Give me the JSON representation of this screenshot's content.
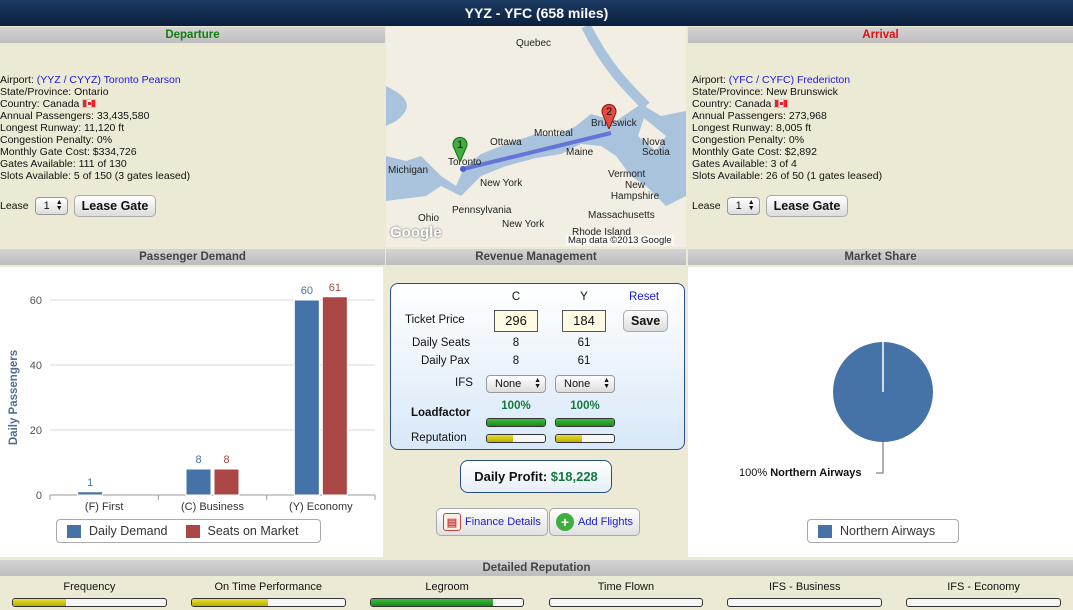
{
  "title": "YYZ - YFC (658 miles)",
  "departure": {
    "header": "Departure",
    "airport_label": "Airport:",
    "airport_value": "(YYZ / CYYZ) Toronto Pearson",
    "rows": [
      "State/Province: Ontario",
      "Country: Canada",
      "Annual Passengers: 33,435,580",
      "Longest Runway: 11,120 ft",
      "Congestion Penalty: 0%",
      "Monthly Gate Cost: $334,726",
      "Gates Available: 111 of 130",
      "Slots Available: 5 of 150 (3 gates leased)"
    ],
    "lease_label": "Lease",
    "lease_value": "1",
    "lease_button": "Lease Gate"
  },
  "arrival": {
    "header": "Arrival",
    "airport_label": "Airport:",
    "airport_value": "(YFC / CYFC) Fredericton",
    "rows": [
      "State/Province: New Brunswick",
      "Country: Canada",
      "Annual Passengers: 273,968",
      "Longest Runway: 8,005 ft",
      "Congestion Penalty: 0%",
      "Monthly Gate Cost: $2,892",
      "Gates Available: 3 of 4",
      "Slots Available: 26 of 50 (1 gates leased)"
    ],
    "lease_label": "Lease",
    "lease_value": "1",
    "lease_button": "Lease Gate"
  },
  "map": {
    "labels": [
      "Quebec",
      "Ottawa",
      "Montreal",
      "Brunswick",
      "Nova Scotia",
      "Maine",
      "Toronto",
      "Michigan",
      "New York",
      "Vermont",
      "New Hampshire",
      "Pennsylvania",
      "Massachusetts",
      "Ohio",
      "New York",
      "Rhode Island"
    ],
    "marker_1": "1",
    "marker_2": "2",
    "logo": "Google",
    "attribution": "Map data ©2013 Google"
  },
  "passenger_demand": {
    "header": "Passenger Demand",
    "legend_demand": "Daily Demand",
    "legend_seats": "Seats on Market"
  },
  "chart_data": {
    "type": "bar",
    "categories": [
      "(F) First",
      "(C) Business",
      "(Y) Economy"
    ],
    "series": [
      {
        "name": "Daily Demand",
        "values": [
          1,
          8,
          60
        ],
        "color": "#4572A7"
      },
      {
        "name": "Seats on Market",
        "values": [
          0,
          8,
          61
        ],
        "color": "#AA4643"
      }
    ],
    "ylabel": "Daily Passengers",
    "ylim": [
      0,
      60
    ],
    "yticks": [
      0,
      20,
      40,
      60
    ],
    "data_labels": [
      "1",
      "",
      "8",
      "8",
      "60",
      "61"
    ]
  },
  "revenue": {
    "header": "Revenue Management",
    "col_c": "C",
    "col_y": "Y",
    "reset": "Reset",
    "ticket_price_label": "Ticket Price",
    "price_c": "296",
    "price_y": "184",
    "save": "Save",
    "daily_seats_label": "Daily Seats",
    "seats_c": "8",
    "seats_y": "61",
    "daily_pax_label": "Daily Pax",
    "pax_c": "8",
    "pax_y": "61",
    "ifs_label": "IFS",
    "ifs_c": "None",
    "ifs_y": "None",
    "loadfactor_label": "Loadfactor",
    "lf_c": "100%",
    "lf_y": "100%",
    "lf_c_value": 1.0,
    "lf_y_value": 1.0,
    "reputation_label": "Reputation",
    "rep_c_value": 0.45,
    "rep_y_value": 0.45,
    "profit_label": "Daily Profit:",
    "profit_value": "$18,228",
    "finance_button": "Finance Details",
    "add_flights_button": "Add Flights"
  },
  "market_share": {
    "header": "Market Share",
    "slice_label_pct": "100%",
    "slice_label_name": "Northern Airways",
    "legend": "Northern Airways",
    "share": 1.0,
    "color": "#4572A7"
  },
  "reputation": {
    "header": "Detailed Reputation",
    "items": [
      {
        "label": "Frequency",
        "value": 0.35,
        "color": "yellow"
      },
      {
        "label": "On Time Performance",
        "value": 0.5,
        "color": "yellow"
      },
      {
        "label": "Legroom",
        "value": 0.8,
        "color": "green"
      },
      {
        "label": "Time Flown",
        "value": 0.0,
        "color": "yellow"
      },
      {
        "label": "IFS - Business",
        "value": 0.0,
        "color": "yellow"
      },
      {
        "label": "IFS - Economy",
        "value": 0.0,
        "color": "yellow"
      }
    ]
  },
  "colors": {
    "departure_header": "#0f7d0f",
    "arrival_header": "#e01010",
    "link": "#1a1adb",
    "title_bg": "#0b1f3d"
  }
}
